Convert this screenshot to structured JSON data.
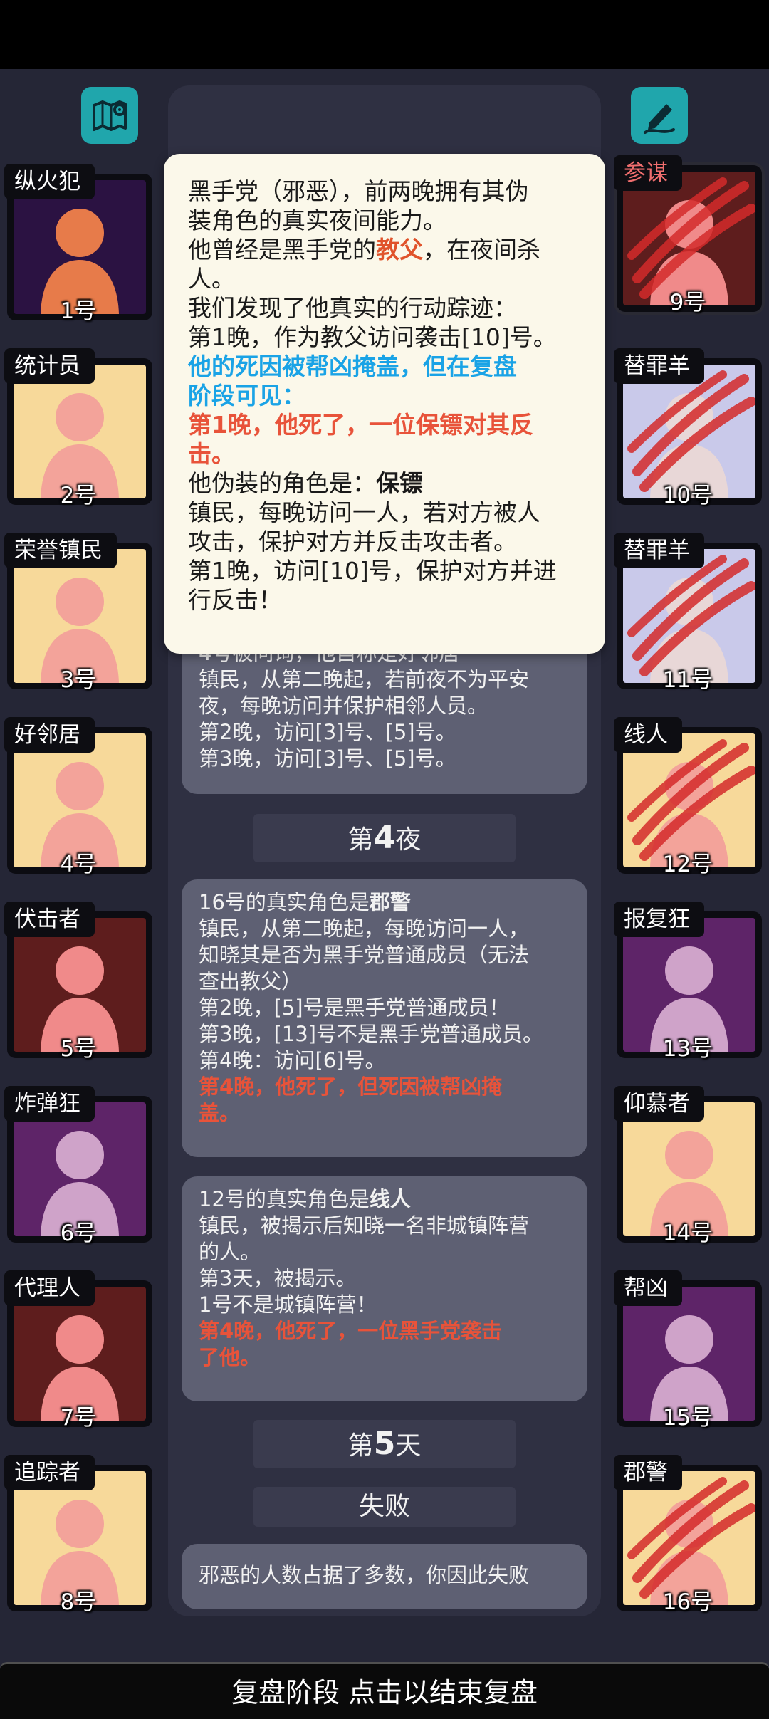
{
  "players_left": [
    {
      "role": "纵火犯",
      "number": "1号",
      "bg": "#2b1242"
    },
    {
      "role": "统计员",
      "number": "2号",
      "bg": "#f7d99a"
    },
    {
      "role": "荣誉镇民",
      "number": "3号",
      "bg": "#f7d99a"
    },
    {
      "role": "好邻居",
      "number": "4号",
      "bg": "#f7d99a"
    },
    {
      "role": "伏击者",
      "number": "5号",
      "bg": "#5e1d1d"
    },
    {
      "role": "炸弹狂",
      "number": "6号",
      "bg": "#5e2468"
    },
    {
      "role": "代理人",
      "number": "7号",
      "bg": "#5e1d1d"
    },
    {
      "role": "追踪者",
      "number": "8号",
      "bg": "#f7d99a"
    }
  ],
  "players_right": [
    {
      "role": "参谋",
      "number": "9号",
      "bg": "#5e1d1d"
    },
    {
      "role": "替罪羊",
      "number": "10号",
      "bg": "#c9c9ea"
    },
    {
      "role": "替罪羊",
      "number": "11号",
      "bg": "#c9c9ea"
    },
    {
      "role": "线人",
      "number": "12号",
      "bg": "#f7d99a"
    },
    {
      "role": "报复狂",
      "number": "13号",
      "bg": "#5e2468"
    },
    {
      "role": "仰慕者",
      "number": "14号",
      "bg": "#f7d99a"
    },
    {
      "role": "帮凶",
      "number": "15号",
      "bg": "#5e2468"
    },
    {
      "role": "郡警",
      "number": "16号",
      "bg": "#f7d99a"
    }
  ],
  "icons": {
    "map": "map-icon",
    "notes": "pen-notes-icon"
  },
  "popup": {
    "line1": "黑手党（邪恶），前两晚拥有其伪",
    "line2": "装角色的真实夜间能力。",
    "line3a": "他曾经是黑手党的",
    "line3b": "教父",
    "line3c": "，在夜间杀",
    "line4": "人。",
    "line5": "我们发现了他真实的行动踪迹：",
    "line6": "第1晚，作为教父访问袭击[10]号。",
    "line7": "他的死因被帮凶掩盖，但在复盘",
    "line8": "阶段可见：",
    "line9": "第1晚，他死了，一位保镖对其反",
    "line10": "击。",
    "line11a": "他伪装的角色是：",
    "line11b": "保镖",
    "line12": "镇民，每晚访问一人，若对方被人",
    "line13": "攻击，保护对方并反击攻击者。",
    "line14": "第1晚，访问[10]号，保护对方并进",
    "line15": "行反击！"
  },
  "log": {
    "entry_top": {
      "line1": "4号被问询，他自称是好邻居",
      "line2": "镇民，从第二晚起，若前夜不为平安",
      "line3": "夜，每晚访问并保护相邻人员。",
      "line4": "第2晚，访问[3]号、[5]号。",
      "line5": "第3晚，访问[3]号、[5]号。"
    },
    "night4": {
      "prefix": "第",
      "num": "4",
      "suffix": "夜"
    },
    "entry_16": {
      "line1a": "16号的真实角色是",
      "line1b": "郡警",
      "line2": "镇民，从第二晚起，每晚访问一人，",
      "line3": "知晓其是否为黑手党普通成员（无法",
      "line4": "查出教父）",
      "line5": "第2晚，[5]号是黑手党普通成员！",
      "line6": "第3晚，[13]号不是黑手党普通成员。",
      "line7": "第4晚：访问[6]号。",
      "line8": "第4晚，他死了，但死因被帮凶掩",
      "line9": "盖。"
    },
    "entry_12": {
      "line1a": "12号的真实角色是",
      "line1b": "线人",
      "line2": "镇民，被揭示后知晓一名非城镇阵营",
      "line3": "的人。",
      "line4": "第3天，被揭示。",
      "line5": "1号不是城镇阵营！",
      "line6": "第4晚，他死了，一位黑手党袭击",
      "line7": "了他。"
    },
    "day5": {
      "prefix": "第",
      "num": "5",
      "suffix": "天"
    },
    "result": "失败",
    "entry_end": "邪恶的人数占据了多数，你因此失败"
  },
  "bottom_bar": "复盘阶段 点击以结束复盘",
  "colors": {
    "background": "#252636",
    "accent_teal": "#20A6AC",
    "popup_bg": "#fbf8ea",
    "highlight_red": "#e8533a",
    "highlight_blue": "#1aa3e6"
  }
}
